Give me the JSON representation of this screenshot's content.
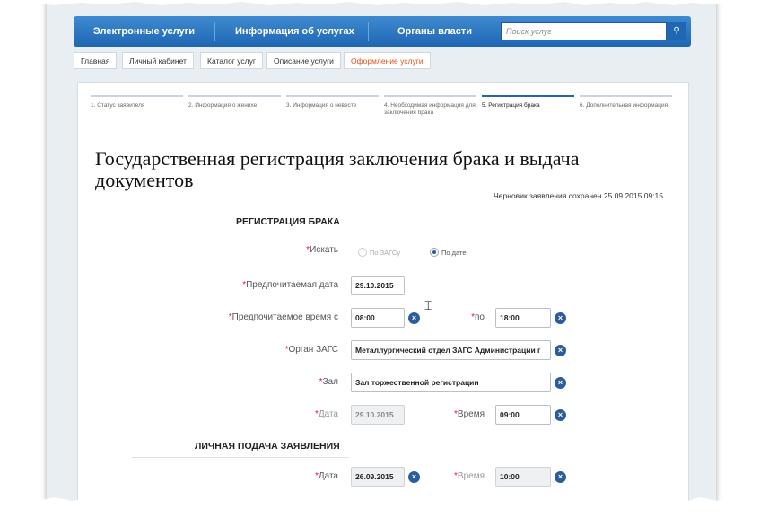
{
  "nav": {
    "items": [
      "Электронные услуги",
      "Информация об услугах",
      "Органы власти"
    ],
    "search_placeholder": "Поиск услуг",
    "search_icon": "search-icon"
  },
  "breadcrumb": [
    "Главная",
    "Личный кабинет",
    "Каталог услуг",
    "Описание услуги",
    "Оформление услуги"
  ],
  "steps": [
    "1. Статус заявителя",
    "2. Информация о женихе",
    "3. Информация о невесте",
    "4. Необходимая информация для заключения брака",
    "5. Регистрация брака",
    "6. Дополнительная информация"
  ],
  "page_title": "Государственная регистрация заключения брака и выдача документов",
  "draft_status": "Черновик заявления сохранен 25.09.2015 09:15",
  "marriage_section": {
    "title": "РЕГИСТРАЦИЯ БРАКА",
    "search_label": "Искать",
    "search_options": [
      "По ЗАГСу",
      "По дате"
    ],
    "search_selected": "По дате",
    "preferred_date_label": "Предпочитаемая дата",
    "preferred_date": "29.10.2015",
    "preferred_time_label": "Предпочитаемое время с",
    "preferred_time_from": "08:00",
    "to_label": "по",
    "preferred_time_to": "18:00",
    "office_label": "Орган ЗАГС",
    "office_value": "Металлургический отдел ЗАГС Администрации г",
    "hall_label": "Зал",
    "hall_value": "Зал торжественной регистрации",
    "date_label": "Дата",
    "date_value": "29.10.2015",
    "time_label": "Время",
    "time_value": "09:00"
  },
  "submission_section": {
    "title": "ЛИЧНАЯ ПОДАЧА ЗАЯВЛЕНИЯ",
    "date_label": "Дата",
    "date_value": "26.09.2015",
    "time_label": "Время",
    "time_value": "10:00"
  },
  "glyphs": {
    "clear": "×",
    "search": "⚲",
    "required": "*"
  }
}
